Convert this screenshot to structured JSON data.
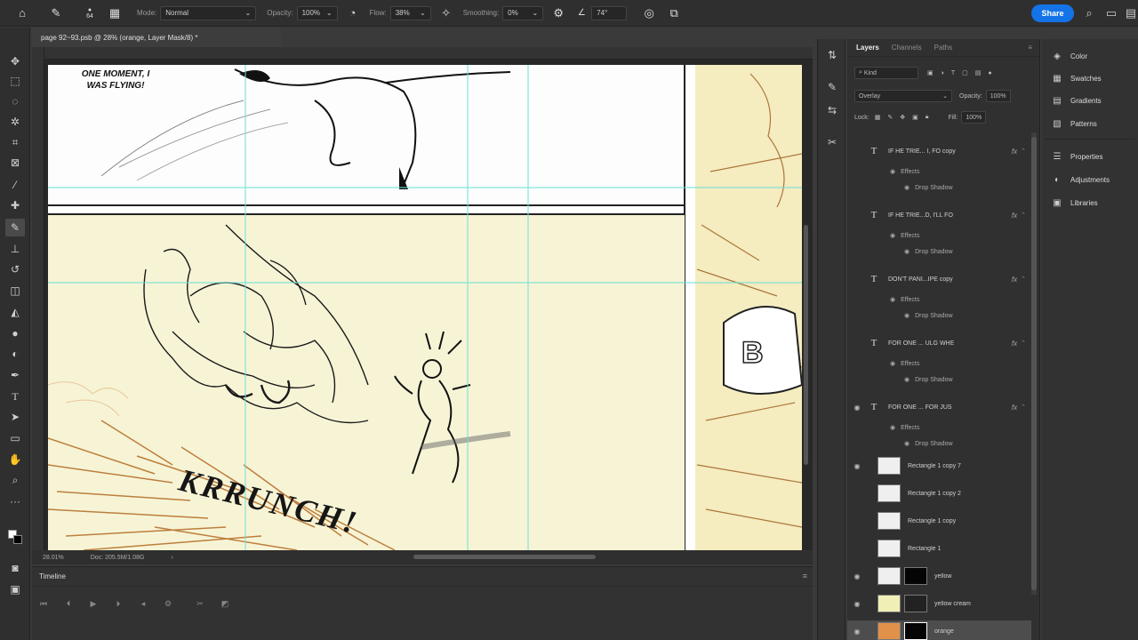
{
  "options_bar": {
    "brush_size": "64",
    "mode_label": "Mode:",
    "mode_value": "Normal",
    "opacity_label": "Opacity:",
    "opacity_value": "100%",
    "flow_label": "Flow:",
    "flow_value": "38%",
    "smoothing_label": "Smoothing:",
    "smoothing_value": "0%",
    "angle_value": "74°",
    "share_label": "Share"
  },
  "document": {
    "tab_title": "page 92~93.psb @ 28% (orange, Layer Mask/8) *",
    "zoom_status": "28.01%",
    "doc_info": "Doc: 205.5M/1.08G",
    "caption": "ONE MOMENT, I WAS FLYING!",
    "sfx": "KRRUNCH!"
  },
  "timeline": {
    "title": "Timeline"
  },
  "layers_panel": {
    "tabs": [
      "Layers",
      "Channels",
      "Paths"
    ],
    "filter_kind": "Kind",
    "blend_mode": "Overlay",
    "opacity_label": "Opacity:",
    "opacity_value": "100%",
    "lock_label": "Lock:",
    "fill_label": "Fill:",
    "fill_value": "100%",
    "layers": [
      {
        "type": "text",
        "name": "IF HE TRIE... I, FO copy",
        "visible": false
      },
      {
        "type": "sub",
        "name": "Effects"
      },
      {
        "type": "sub2",
        "name": "Drop Shadow"
      },
      {
        "type": "text",
        "name": "IF HE TRIE...D, I'LL FO",
        "visible": false
      },
      {
        "type": "sub",
        "name": "Effects"
      },
      {
        "type": "sub2",
        "name": "Drop Shadow"
      },
      {
        "type": "text",
        "name": "DON'T PANI...IPE copy",
        "visible": false
      },
      {
        "type": "sub",
        "name": "Effects"
      },
      {
        "type": "sub2",
        "name": "Drop Shadow"
      },
      {
        "type": "text",
        "name": "FOR ONE ... ULG WHE",
        "visible": false
      },
      {
        "type": "sub",
        "name": "Effects"
      },
      {
        "type": "sub2",
        "name": "Drop Shadow"
      },
      {
        "type": "text",
        "name": "FOR ONE ... FOR JUS",
        "visible": true
      },
      {
        "type": "sub",
        "name": "Effects"
      },
      {
        "type": "sub2",
        "name": "Drop Shadow"
      },
      {
        "type": "rect",
        "name": "Rectangle 1 copy 7",
        "visible": true
      },
      {
        "type": "rect",
        "name": "Rectangle 1 copy 2",
        "visible": false
      },
      {
        "type": "rect",
        "name": "Rectangle 1 copy",
        "visible": false
      },
      {
        "type": "rect",
        "name": "Rectangle 1",
        "visible": false
      },
      {
        "type": "masked",
        "name": "yellow",
        "visible": true,
        "thumb": "white"
      },
      {
        "type": "masked",
        "name": "yellow cream",
        "visible": true,
        "thumb": "yellow"
      },
      {
        "type": "masked",
        "name": "orange",
        "visible": true,
        "thumb": "orange",
        "selected": true
      }
    ]
  },
  "right_panel": {
    "group1": [
      "Color",
      "Swatches",
      "Gradients",
      "Patterns"
    ],
    "group2": [
      "Properties",
      "Adjustments",
      "Libraries"
    ]
  },
  "colors": {
    "accent": "#1473e6",
    "guide": "#6fe0d8",
    "panel_yellow": "#f7f4d6"
  }
}
